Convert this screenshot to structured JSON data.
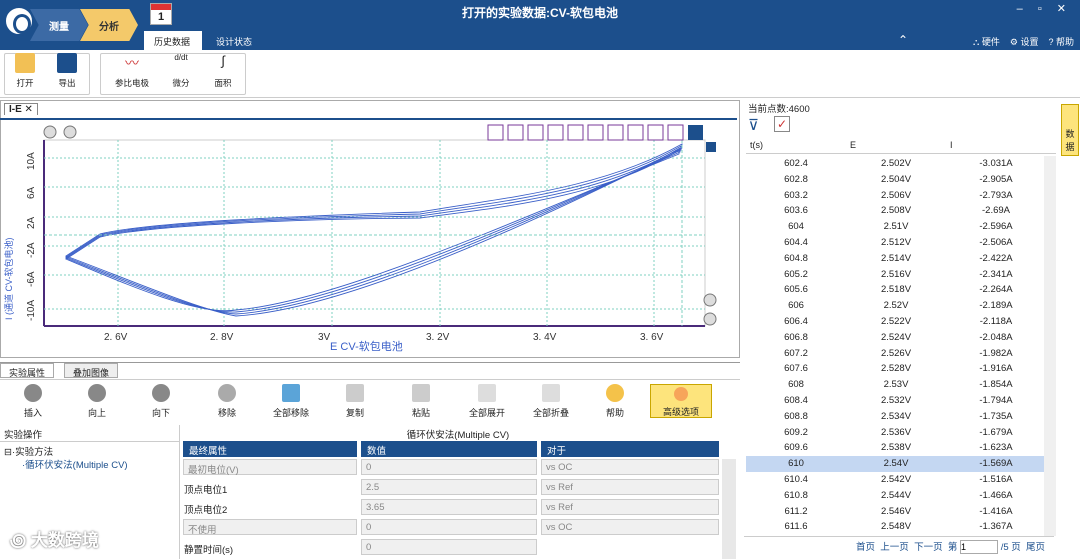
{
  "window": {
    "title": "打开的实验数据:CV-软包电池",
    "controls": "– ▫ ✕"
  },
  "nav": {
    "step1": "测量",
    "step2": "分析",
    "calendar": "1",
    "tab1": "历史数据",
    "tab2": "设计状态"
  },
  "menu": {
    "hardware": "硬件",
    "settings": "设置",
    "help": "帮助"
  },
  "ribbon": {
    "open": "打开",
    "export": "导出",
    "ref": "参比电极",
    "diff": "微分",
    "area": "面积"
  },
  "plot": {
    "tab": "I-E",
    "xlabel": "E    CV-软包电池",
    "ylabel": "I (通道 CV-软包电池)",
    "xticks": [
      "2. 6V",
      "2. 8V",
      "3V",
      "3. 2V",
      "3. 4V",
      "3. 6V"
    ],
    "yticks": [
      "10A",
      "6A",
      "2A",
      "-2A",
      "-6A",
      "-10A"
    ]
  },
  "chart_data": {
    "type": "line",
    "title": "",
    "xlabel": "E    CV-软包电池",
    "ylabel": "I (通道 CV-软包电池)",
    "xlim": [
      2.49,
      3.66
    ],
    "ylim": [
      -12,
      12.5
    ],
    "grid": true
  },
  "bottom": {
    "tab1": "实验属性",
    "tab2": "叠加图像",
    "insert": "插入",
    "up": "向上",
    "down": "向下",
    "remove": "移除",
    "removeall": "全部移除",
    "copy": "复制",
    "paste": "粘贴",
    "expand": "全部展开",
    "collapse": "全部折叠",
    "help": "帮助",
    "advanced": "高级选项",
    "ops": "实验操作",
    "method": "实验方法",
    "item": "循环伏安法(Multiple CV)",
    "gridtitle": "循环伏安法(Multiple CV)",
    "col1": "最终属性",
    "col2": "数值",
    "col3": "对于",
    "rows": [
      {
        "a": "最初电位(V)",
        "b": "0",
        "c": "vs OC"
      },
      {
        "a": "顶点电位1",
        "b": "2.5",
        "c": "vs Ref"
      },
      {
        "a": "顶点电位2",
        "b": "3.65",
        "c": "vs Ref"
      },
      {
        "a": "不使用",
        "b": "0",
        "c": "vs OC"
      },
      {
        "a": "静置时间(s)",
        "b": "0",
        "c": ""
      }
    ]
  },
  "table": {
    "count": "当前点数:4600",
    "h1": "t(s)",
    "h2": "E",
    "h3": "I",
    "side": "数据",
    "rows": [
      [
        "602.4",
        "2.502V",
        "-3.031A"
      ],
      [
        "602.8",
        "2.504V",
        "-2.905A"
      ],
      [
        "603.2",
        "2.506V",
        "-2.793A"
      ],
      [
        "603.6",
        "2.508V",
        "-2.69A"
      ],
      [
        "604",
        "2.51V",
        "-2.596A"
      ],
      [
        "604.4",
        "2.512V",
        "-2.506A"
      ],
      [
        "604.8",
        "2.514V",
        "-2.422A"
      ],
      [
        "605.2",
        "2.516V",
        "-2.341A"
      ],
      [
        "605.6",
        "2.518V",
        "-2.264A"
      ],
      [
        "606",
        "2.52V",
        "-2.189A"
      ],
      [
        "606.4",
        "2.522V",
        "-2.118A"
      ],
      [
        "606.8",
        "2.524V",
        "-2.048A"
      ],
      [
        "607.2",
        "2.526V",
        "-1.982A"
      ],
      [
        "607.6",
        "2.528V",
        "-1.916A"
      ],
      [
        "608",
        "2.53V",
        "-1.854A"
      ],
      [
        "608.4",
        "2.532V",
        "-1.794A"
      ],
      [
        "608.8",
        "2.534V",
        "-1.735A"
      ],
      [
        "609.2",
        "2.536V",
        "-1.679A"
      ],
      [
        "609.6",
        "2.538V",
        "-1.623A"
      ],
      [
        "610",
        "2.54V",
        "-1.569A"
      ],
      [
        "610.4",
        "2.542V",
        "-1.516A"
      ],
      [
        "610.8",
        "2.544V",
        "-1.466A"
      ],
      [
        "611.2",
        "2.546V",
        "-1.416A"
      ],
      [
        "611.6",
        "2.548V",
        "-1.367A"
      ]
    ],
    "pager": {
      "first": "首页",
      "prev": "上一页",
      "next": "下一页",
      "page_prefix": "第",
      "page": "1",
      "total": "/5 页",
      "last": "尾页"
    }
  },
  "watermark": "大数跨境"
}
